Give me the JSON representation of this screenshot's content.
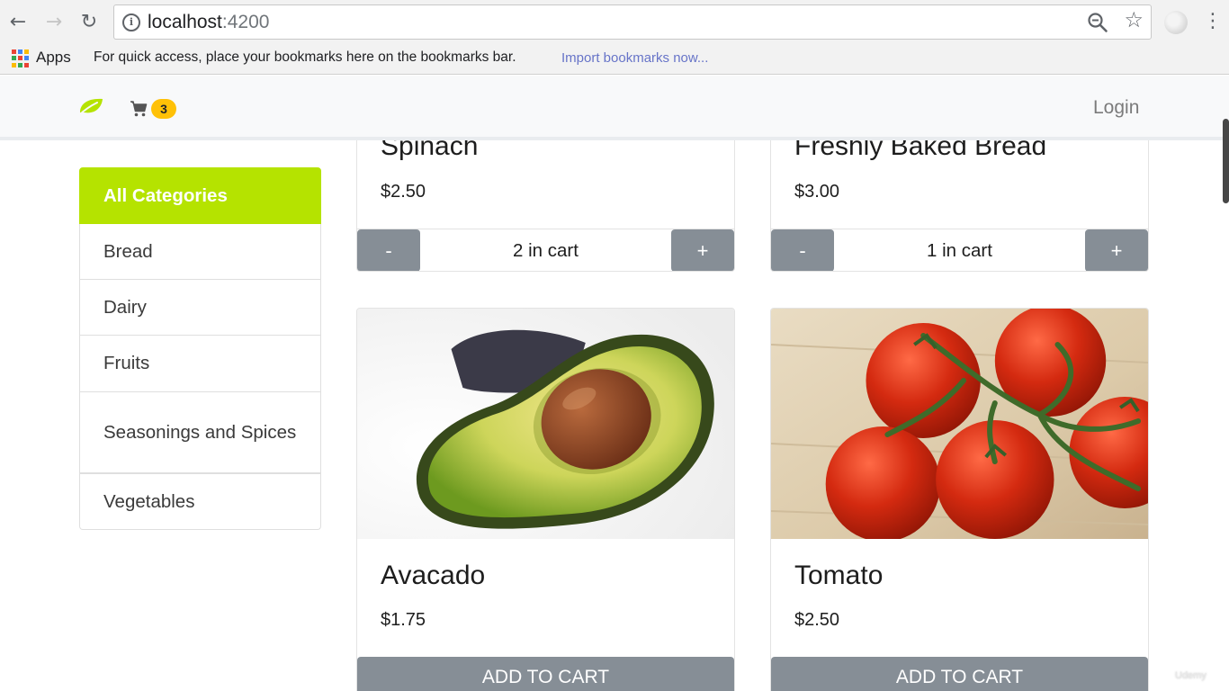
{
  "browser": {
    "url_host": "localhost",
    "url_port": ":4200",
    "bookmarks": {
      "apps_label": "Apps",
      "hint": "For quick access, place your bookmarks here on the bookmarks bar.",
      "import_link": "Import bookmarks now..."
    }
  },
  "colors": {
    "accent": "#b5e300",
    "badge": "#ffc107",
    "button_gray": "#868e96",
    "link_blue": "#6774c8"
  },
  "navbar": {
    "cart_count": "3",
    "login_label": "Login"
  },
  "sidebar": {
    "items": [
      {
        "label": "All Categories",
        "active": true
      },
      {
        "label": "Bread"
      },
      {
        "label": "Dairy"
      },
      {
        "label": "Fruits"
      },
      {
        "label": "Seasonings and Spices"
      },
      {
        "label": "Vegetables"
      }
    ]
  },
  "products": {
    "spinach": {
      "title": "Spinach",
      "price": "$2.50",
      "cart_text": "2 in cart",
      "minus": "-",
      "plus": "+"
    },
    "bread": {
      "title": "Freshly Baked Bread",
      "price": "$3.00",
      "cart_text": "1 in cart",
      "minus": "-",
      "plus": "+"
    },
    "avocado": {
      "title": "Avacado",
      "price": "$1.75",
      "add_label": "ADD TO CART"
    },
    "tomato": {
      "title": "Tomato",
      "price": "$2.50",
      "add_label": "ADD TO CART"
    }
  },
  "watermark": "Udemy"
}
